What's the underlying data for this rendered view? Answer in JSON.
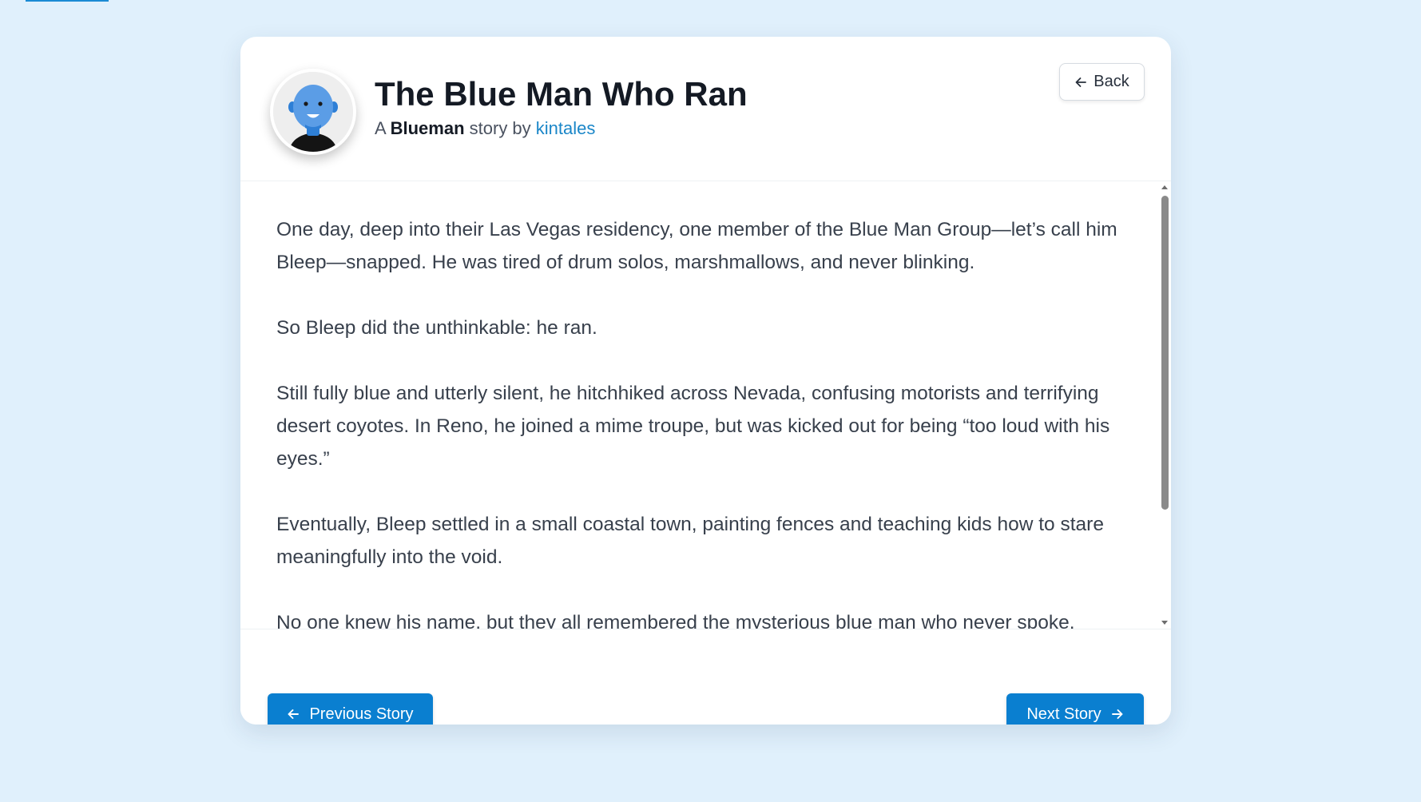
{
  "story": {
    "title": "The Blue Man Who Ran",
    "byline": {
      "prefix": "A",
      "category": "Blueman",
      "middle": "story by",
      "author": "kintales"
    },
    "paragraphs": [
      "One day, deep into their Las Vegas residency, one member of the Blue Man Group—let’s call him Bleep—snapped. He was tired of drum solos, marshmallows, and never blinking.",
      "So Bleep did the unthinkable: he ran.",
      "Still fully blue and utterly silent, he hitchhiked across Nevada, confusing motorists and terrifying desert coyotes. In Reno, he joined a mime troupe, but was kicked out for being “too loud with his eyes.”",
      "Eventually, Bleep settled in a small coastal town, painting fences and teaching kids how to stare meaningfully into the void.",
      "No one knew his name, but they all remembered the mysterious blue man who never spoke."
    ]
  },
  "header": {
    "back_label": "Back",
    "avatar_icon": "blue-man-avatar-icon"
  },
  "footer": {
    "previous_label": "Previous Story",
    "next_label": "Next Story"
  },
  "colors": {
    "background": "#e0f0fc",
    "accent": "#0a7fd0",
    "link": "#1a86c8",
    "avatar_skin": "#5b9de6"
  }
}
